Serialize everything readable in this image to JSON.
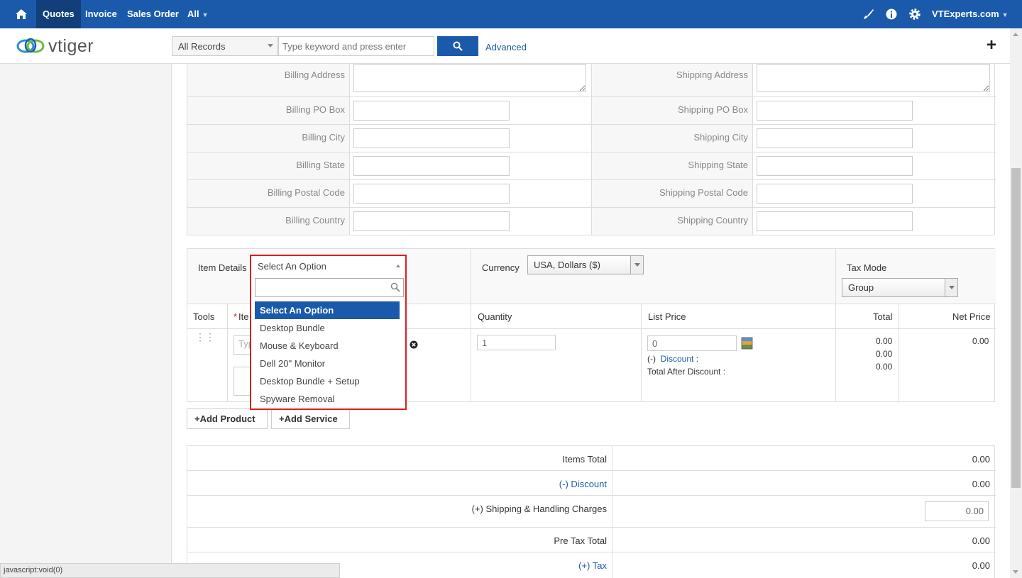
{
  "nav": {
    "tabs": [
      "Quotes",
      "Invoice",
      "Sales Order",
      "All"
    ],
    "user": "VTExperts.com",
    "colors": {
      "primary": "#1b5aab",
      "active_tab": "#123f7a",
      "highlight_border": "#d9201f"
    }
  },
  "header": {
    "logo_text": "vtiger",
    "record_filter": "All Records",
    "search_placeholder": "Type keyword and press enter",
    "advanced_label": "Advanced"
  },
  "address": {
    "billing": [
      "Billing Address",
      "Billing PO Box",
      "Billing City",
      "Billing State",
      "Billing Postal Code",
      "Billing Country"
    ],
    "shipping": [
      "Shipping Address",
      "Shipping PO Box",
      "Shipping City",
      "Shipping State",
      "Shipping Postal Code",
      "Shipping Country"
    ]
  },
  "items": {
    "item_details_label": "Item Details",
    "currency_label": "Currency",
    "currency_value": "USA, Dollars ($)",
    "tax_mode_label": "Tax Mode",
    "tax_mode_value": "Group",
    "columns": {
      "tools": "Tools",
      "item_prefix": "*",
      "item": "Ite",
      "quantity": "Quantity",
      "list_price": "List Price",
      "total": "Total",
      "net_price": "Net Price"
    },
    "row": {
      "item_placeholder": "Typ",
      "quantity": "1",
      "list_price": "0",
      "discount_prefix": "(-)",
      "discount_label": "Discount",
      "discount_suffix": " :",
      "total_after_discount": "Total After Discount :",
      "totals": [
        "0.00",
        "0.00",
        "0.00"
      ],
      "net_price": "0.00"
    },
    "dropdown": {
      "current": "Select An Option",
      "options": [
        "Select An Option",
        "Desktop Bundle",
        "Mouse & Keyboard",
        "Dell 20\" Monitor",
        "Desktop Bundle + Setup",
        "Spyware Removal"
      ]
    },
    "add_product": "Add Product",
    "add_service": "Add Service"
  },
  "totals": {
    "items_total_label": "Items Total",
    "items_total": "0.00",
    "discount_prefix": "(-)",
    "discount_label": "Discount",
    "discount_value": "0.00",
    "shipping_prefix": "(+)",
    "shipping_label": "Shipping & Handling Charges",
    "shipping_value": "0.00",
    "pre_tax_label": "Pre Tax Total",
    "pre_tax_value": "0.00",
    "tax_prefix": "(+)",
    "tax_label": "Tax",
    "tax_value": "0.00"
  },
  "status_bar": "javascript:void(0)"
}
